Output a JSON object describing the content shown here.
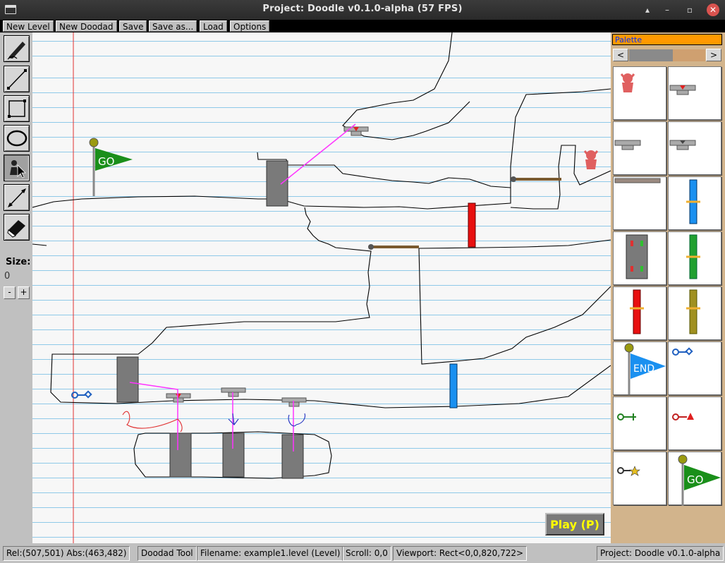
{
  "window": {
    "title": "Project: Doodle v0.1.0-alpha (57 FPS)",
    "min": "▴",
    "restore": "–",
    "maximize": "▫",
    "close": "✕"
  },
  "menu": [
    {
      "label": "New Level"
    },
    {
      "label": "New Doodad"
    },
    {
      "label": "Save"
    },
    {
      "label": "Save as..."
    },
    {
      "label": "Load"
    },
    {
      "label": "Options"
    }
  ],
  "tools": [
    {
      "icon": "pencil-icon"
    },
    {
      "icon": "line-icon"
    },
    {
      "icon": "rectangle-icon"
    },
    {
      "icon": "ellipse-icon"
    },
    {
      "icon": "doodad-actor-icon"
    },
    {
      "icon": "link-tool-icon"
    },
    {
      "icon": "eraser-icon"
    }
  ],
  "size": {
    "label": "Size:",
    "value": "0",
    "minus": "-",
    "plus": "+"
  },
  "canvas": {
    "go_flag_text": "GO",
    "play_button": "Play (P)"
  },
  "palette": {
    "title": "Palette",
    "prev": "<",
    "next": ">",
    "items": [
      {
        "icon": "azulian-red-icon"
      },
      {
        "icon": "button-down-icon"
      },
      {
        "icon": "button-icon"
      },
      {
        "icon": "button-sticky-icon"
      },
      {
        "icon": "crumbly-floor-icon"
      },
      {
        "icon": "blue-door-icon"
      },
      {
        "icon": "electric-door-icon"
      },
      {
        "icon": "green-door-icon"
      },
      {
        "icon": "red-door-icon"
      },
      {
        "icon": "locked-door-icon"
      },
      {
        "icon": "end-flag-icon"
      },
      {
        "icon": "blue-key-icon"
      },
      {
        "icon": "green-key-icon"
      },
      {
        "icon": "red-key-icon"
      },
      {
        "icon": "gold-key-icon"
      },
      {
        "icon": "go-flag-icon"
      }
    ],
    "end_flag_text": "END",
    "go_flag_text": "GO"
  },
  "status": {
    "rel": "Rel:(507,501)  Abs:(463,482)",
    "tool": "Doodad Tool",
    "filename": "Filename: example1.level (Level)",
    "scroll": "Scroll: 0,0",
    "viewport": "Viewport: Rect<0,0,820,722>",
    "project": "Project: Doodle v0.1.0-alpha"
  },
  "colors": {
    "accent_orange": "#ff9900",
    "palette_bg": "#d2b48c",
    "ruled_line": "#8fc9e8",
    "margin_line": "#e03030",
    "link_line": "#ff33ff",
    "play_text": "#ffff00"
  }
}
